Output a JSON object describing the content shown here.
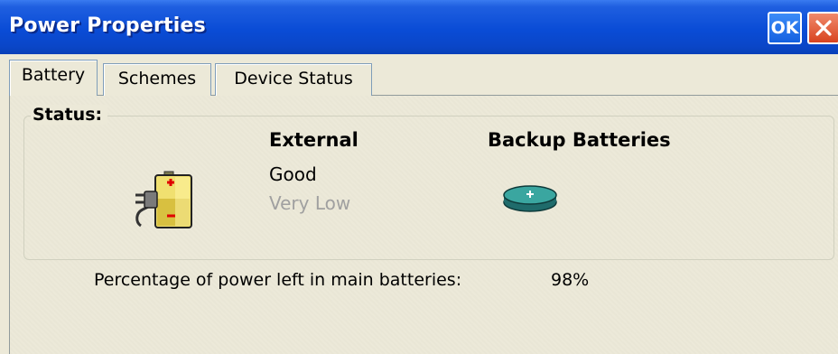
{
  "window": {
    "title": "Power Properties",
    "ok_label": "OK"
  },
  "tabs": [
    {
      "label": "Battery",
      "active": true
    },
    {
      "label": "Schemes",
      "active": false
    },
    {
      "label": "Device Status",
      "active": false
    }
  ],
  "status": {
    "legend": "Status:",
    "external": {
      "heading": "External",
      "condition": "Good",
      "level": "Very Low",
      "icon": "plugged-battery-icon"
    },
    "backup": {
      "heading": "Backup Batteries",
      "icon": "coin-cell-battery-icon"
    }
  },
  "main_battery": {
    "label": "Percentage of power left in main batteries:",
    "value": "98%"
  },
  "colors": {
    "titlebar": "#0a4cd6",
    "window_bg": "#ece9d8",
    "dim_text": "#a0a0a0",
    "close_button": "#d8431f"
  }
}
